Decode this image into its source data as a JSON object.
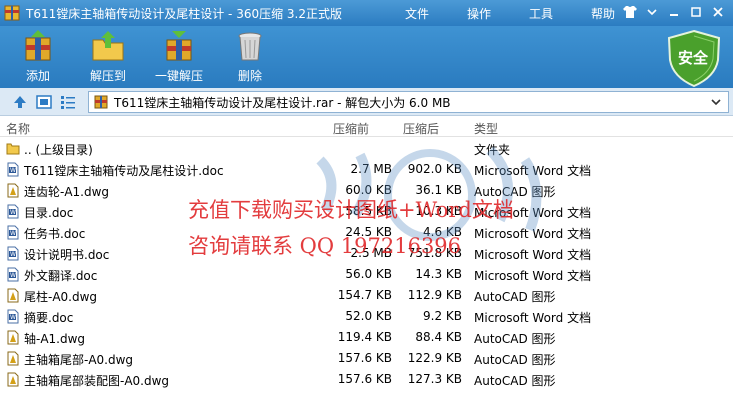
{
  "window": {
    "title": "T611镗床主轴箱传动设计及尾柱设计 - 360压缩 3.2正式版",
    "menus": [
      "文件",
      "操作",
      "工具",
      "帮助"
    ]
  },
  "toolbar": {
    "add_label": "添加",
    "extract_to_label": "解压到",
    "one_click_extract_label": "一键解压",
    "delete_label": "删除",
    "security_label": "安全"
  },
  "addressbar": {
    "path": "T611镗床主轴箱传动设计及尾柱设计.rar - 解包大小为 6.0 MB"
  },
  "columns": {
    "name": "名称",
    "size": "压缩前",
    "compressed": "压缩后",
    "type": "类型"
  },
  "files": [
    {
      "name": ".. (上级目录)",
      "size": "",
      "compressed": "",
      "type": "文件夹",
      "icon": "folder-icon"
    },
    {
      "name": "T611镗床主轴箱传动及尾柱设计.doc",
      "size": "2.7 MB",
      "compressed": "902.0 KB",
      "type": "Microsoft Word 文档",
      "icon": "doc-icon"
    },
    {
      "name": "连齿轮-A1.dwg",
      "size": "60.0 KB",
      "compressed": "36.1 KB",
      "type": "AutoCAD 图形",
      "icon": "dwg-icon"
    },
    {
      "name": "目录.doc",
      "size": "58.5 KB",
      "compressed": "10.3 KB",
      "type": "Microsoft Word 文档",
      "icon": "doc-icon"
    },
    {
      "name": "任务书.doc",
      "size": "24.5 KB",
      "compressed": "4.6 KB",
      "type": "Microsoft Word 文档",
      "icon": "doc-icon"
    },
    {
      "name": "设计说明书.doc",
      "size": "2.5 MB",
      "compressed": "751.8 KB",
      "type": "Microsoft Word 文档",
      "icon": "doc-icon"
    },
    {
      "name": "外文翻译.doc",
      "size": "56.0 KB",
      "compressed": "14.3 KB",
      "type": "Microsoft Word 文档",
      "icon": "doc-icon"
    },
    {
      "name": "尾柱-A0.dwg",
      "size": "154.7 KB",
      "compressed": "112.9 KB",
      "type": "AutoCAD 图形",
      "icon": "dwg-icon"
    },
    {
      "name": "摘要.doc",
      "size": "52.0 KB",
      "compressed": "9.2 KB",
      "type": "Microsoft Word 文档",
      "icon": "doc-icon"
    },
    {
      "name": "轴-A1.dwg",
      "size": "119.4 KB",
      "compressed": "88.4 KB",
      "type": "AutoCAD 图形",
      "icon": "dwg-icon"
    },
    {
      "name": "主轴箱尾部-A0.dwg",
      "size": "157.6 KB",
      "compressed": "122.9 KB",
      "type": "AutoCAD 图形",
      "icon": "dwg-icon"
    },
    {
      "name": "主轴箱尾部装配图-A0.dwg",
      "size": "157.6 KB",
      "compressed": "127.3 KB",
      "type": "AutoCAD 图形",
      "icon": "dwg-icon"
    }
  ],
  "watermark": {
    "line1": "充值下载购买设计图纸+Word文档",
    "line2": "咨询请联系  QQ 1972163​96"
  },
  "colors": {
    "titlebar": "#2b7cc1",
    "toolbar": "#2a7bbf",
    "watermark_text": "#e0282a",
    "security_shield": "#4aa02c"
  }
}
